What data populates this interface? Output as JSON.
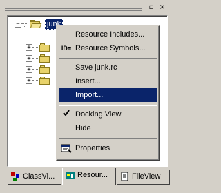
{
  "window": {
    "restore_glyph": "▫",
    "close_glyph": "×"
  },
  "tree": {
    "root_label": "junk",
    "root_expander": "−",
    "child_expander": "+",
    "children_count_visible": 4
  },
  "context_menu": {
    "items": [
      {
        "label": "Resource Includes...",
        "icon": "",
        "highlighted": false
      },
      {
        "label": "Resource Symbols...",
        "icon": "ID=",
        "highlighted": false
      },
      {
        "label": "Save junk.rc",
        "icon": "",
        "highlighted": false
      },
      {
        "label": "Insert...",
        "icon": "",
        "highlighted": false
      },
      {
        "label": "Import...",
        "icon": "",
        "highlighted": true
      },
      {
        "label": "Docking View",
        "icon": "checkmark-icon",
        "highlighted": false
      },
      {
        "label": "Hide",
        "icon": "",
        "highlighted": false
      },
      {
        "label": "Properties",
        "icon": "properties-icon",
        "highlighted": false
      }
    ]
  },
  "tabs": [
    {
      "label": "ClassVi...",
      "icon": "classview-icon"
    },
    {
      "label": "Resour...",
      "icon": "resourceview-icon",
      "active": true
    },
    {
      "label": "FileView",
      "icon": "fileview-icon"
    }
  ],
  "colors": {
    "highlight": "#0a246a",
    "face": "#d4d0c8",
    "folder": "#e8d36b"
  }
}
